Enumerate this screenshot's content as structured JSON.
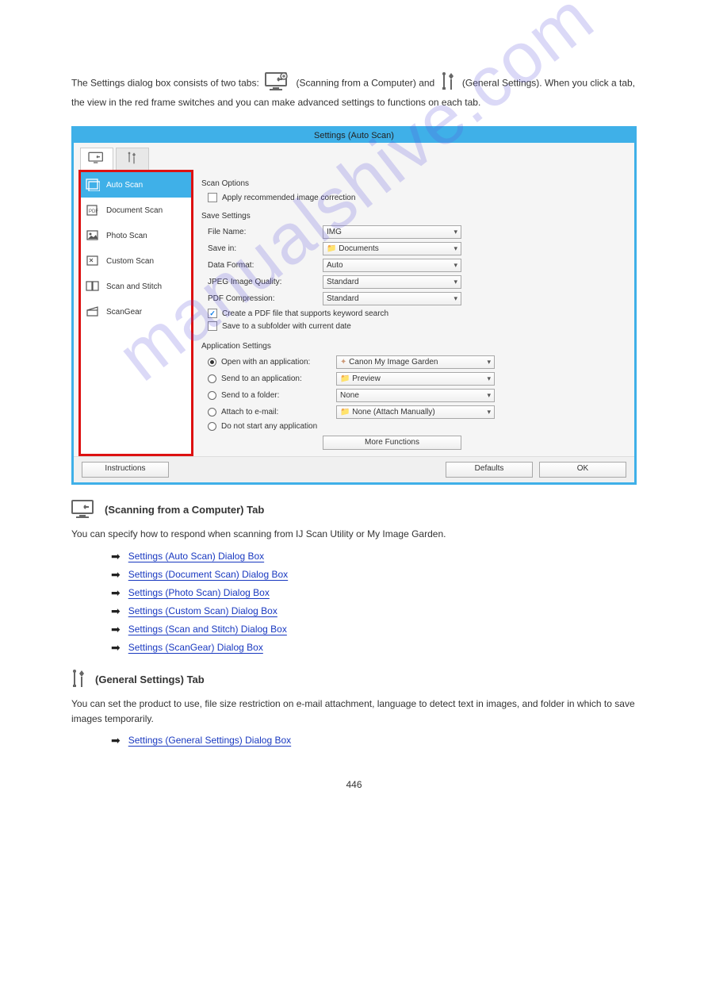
{
  "watermark": "manualshive.com",
  "intro": {
    "t1": "The Settings dialog box consists of two tabs: ",
    "t2": " (Scanning from a Computer) and ",
    "t3": " (General Settings). When you click a tab, the view in the red frame switches and you can make advanced settings to functions on each tab."
  },
  "window": {
    "title": "Settings (Auto Scan)",
    "sidebar": [
      {
        "label": "Auto Scan",
        "selected": true
      },
      {
        "label": "Document Scan"
      },
      {
        "label": "Photo Scan"
      },
      {
        "label": "Custom Scan"
      },
      {
        "label": "Scan and Stitch"
      },
      {
        "label": "ScanGear"
      }
    ],
    "scan_options": {
      "title": "Scan Options",
      "apply_corr": "Apply recommended image correction"
    },
    "save_settings": {
      "title": "Save Settings",
      "filename_label": "File Name:",
      "filename_value": "IMG",
      "savein_label": "Save in:",
      "savein_value": "Documents",
      "dataformat_label": "Data Format:",
      "dataformat_value": "Auto",
      "jpeg_label": "JPEG Image Quality:",
      "jpeg_value": "Standard",
      "pdf_label": "PDF Compression:",
      "pdf_value": "Standard",
      "keyword_chk": "Create a PDF file that supports keyword search",
      "subfolder_chk": "Save to a subfolder with current date"
    },
    "app_settings": {
      "title": "Application Settings",
      "open_label": "Open with an application:",
      "open_value": "Canon My Image Garden",
      "sendapp_label": "Send to an application:",
      "sendapp_value": "Preview",
      "sendfolder_label": "Send to a folder:",
      "sendfolder_value": "None",
      "attach_label": "Attach to e-mail:",
      "attach_value": "None (Attach Manually)",
      "donot_label": "Do not start any application",
      "more_label": "More Functions"
    },
    "buttons": {
      "instructions": "Instructions",
      "defaults": "Defaults",
      "ok": "OK"
    }
  },
  "section1": {
    "head": "(Scanning from a Computer) Tab",
    "para": "You can specify how to respond when scanning from IJ Scan Utility or My Image Garden.",
    "links": [
      "Settings (Auto Scan) Dialog Box",
      "Settings (Document Scan) Dialog Box",
      "Settings (Photo Scan) Dialog Box",
      "Settings (Custom Scan) Dialog Box",
      "Settings (Scan and Stitch) Dialog Box",
      "Settings (ScanGear) Dialog Box"
    ]
  },
  "section2": {
    "head": "(General Settings) Tab",
    "para": "You can set the product to use, file size restriction on e-mail attachment, language to detect text in images, and folder in which to save images temporarily.",
    "links": [
      "Settings (General Settings) Dialog Box"
    ]
  },
  "page_number": "446"
}
